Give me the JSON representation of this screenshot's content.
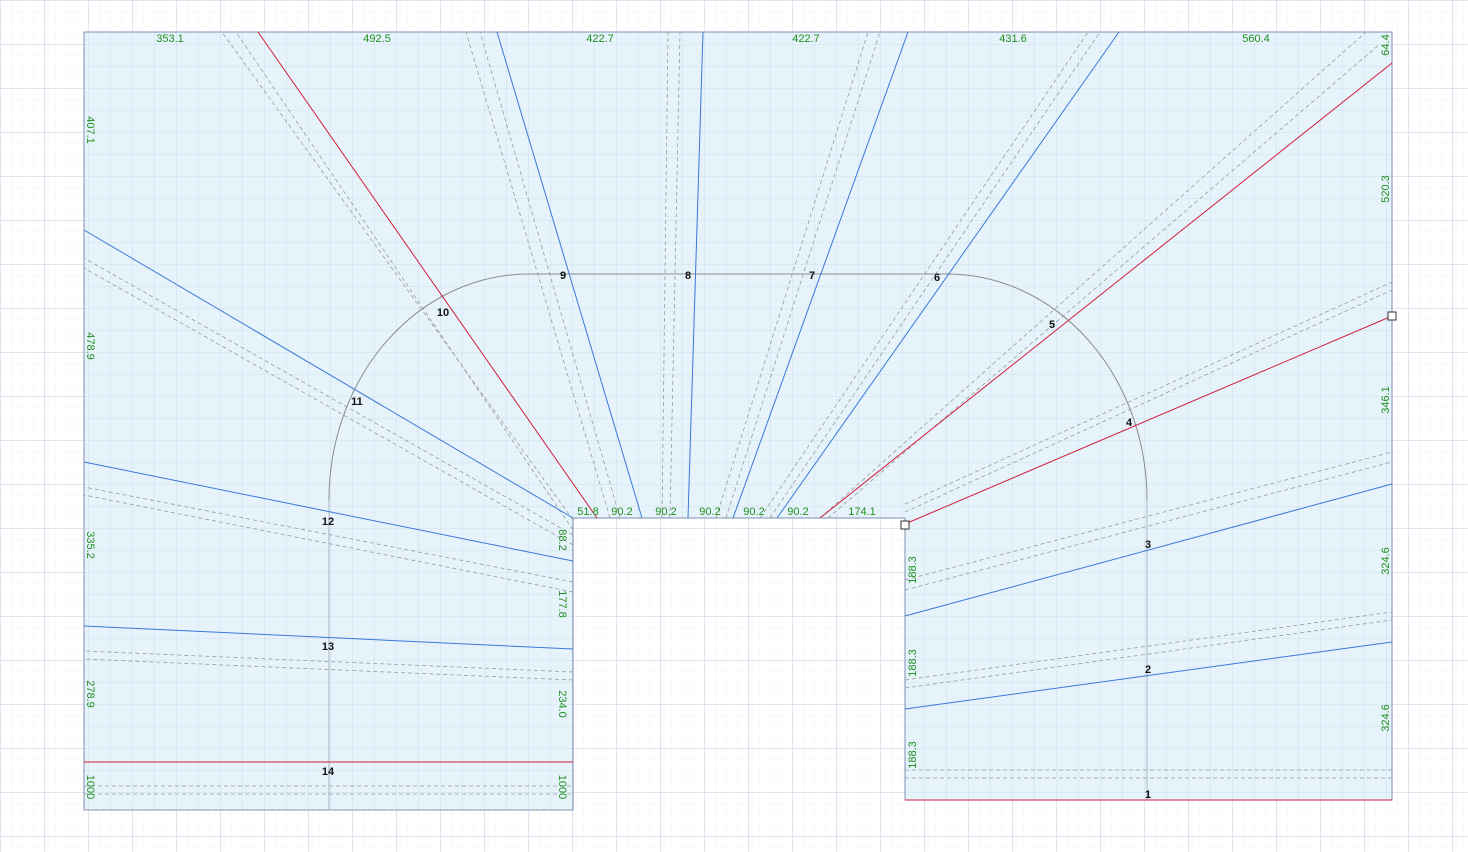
{
  "colors": {
    "grid_minor": "#d9dcec",
    "grid_major": "#b9bfe0",
    "region_fill": "#e6f3fa",
    "region_grid": "#b8cde6",
    "outline": "#7d8fb0",
    "stringer": "#a9b7c6",
    "blue_line": "#3b78d8",
    "red_line": "#d11f3c",
    "dashed": "#9a9a9a",
    "arc": "#8c8c8c",
    "dim_text": "#1f8f1f",
    "step_text": "#111111"
  },
  "dimensions": {
    "top": [
      "353.1",
      "492.5",
      "422.7",
      "422.7",
      "431.6",
      "560.4"
    ],
    "landing_edge": [
      "51.8",
      "90.2",
      "90.2",
      "90.2",
      "90.2",
      "90.2",
      "174.1"
    ],
    "left_outer": [
      "407.1",
      "478.9",
      "335.2",
      "278.9",
      "1000"
    ],
    "left_inner": [
      "88.2",
      "177.8",
      "234.0",
      "1000"
    ],
    "right_outer": [
      "64.4",
      "520.3",
      "346.1",
      "324.6",
      "324.6"
    ],
    "right_inner": [
      "188.3",
      "188.3",
      "188.3"
    ]
  },
  "steps": [
    "1",
    "2",
    "3",
    "4",
    "5",
    "6",
    "7",
    "8",
    "9",
    "10",
    "11",
    "12",
    "13",
    "14"
  ],
  "handles": [
    "corner-handle",
    "right-edge-handle"
  ]
}
